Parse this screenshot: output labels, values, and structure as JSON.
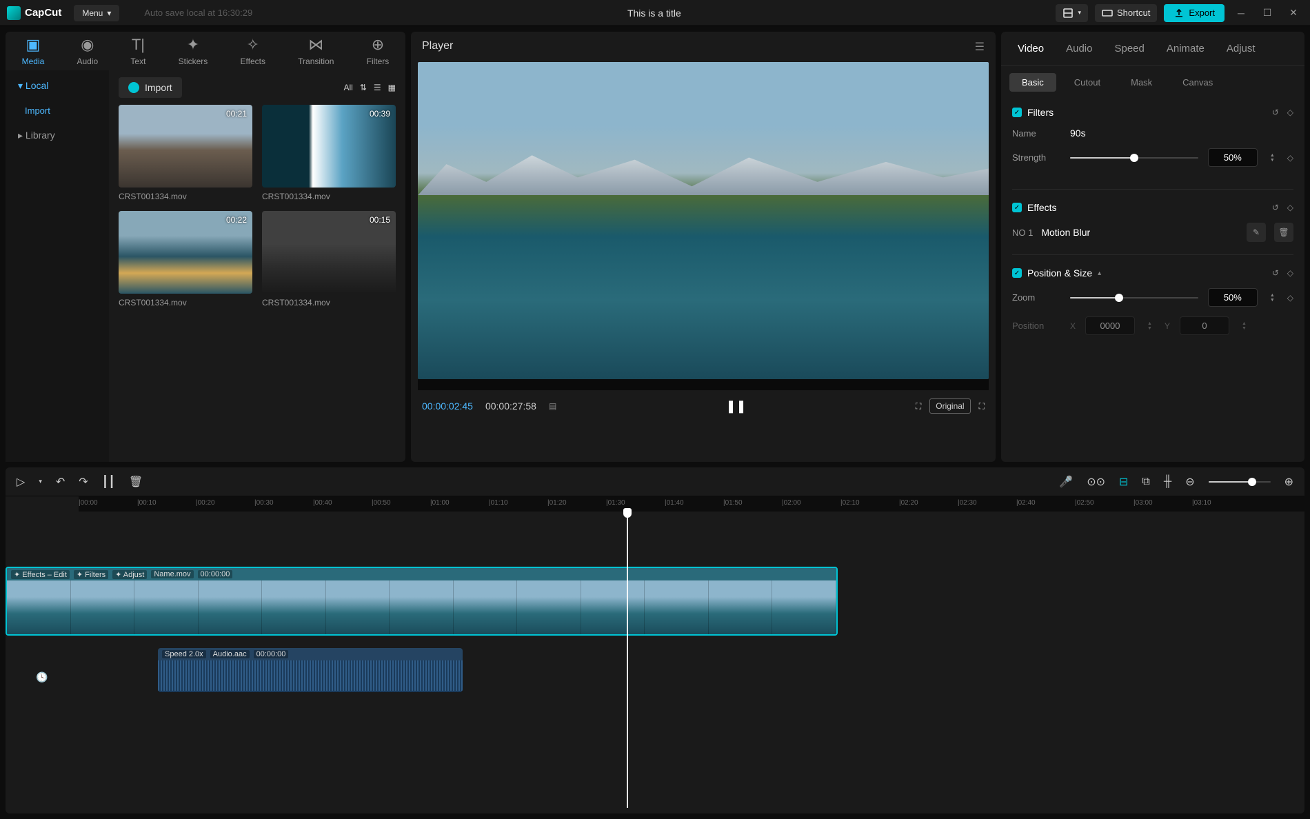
{
  "app": {
    "name": "CapCut",
    "menu_label": "Menu",
    "autosave": "Auto save local at 16:30:29",
    "title": "This is a title",
    "shortcut_label": "Shortcut",
    "export_label": "Export"
  },
  "tools": [
    {
      "label": "Media",
      "id": "media-tool",
      "active": true
    },
    {
      "label": "Audio",
      "id": "audio-tool",
      "active": false
    },
    {
      "label": "Text",
      "id": "text-tool",
      "active": false
    },
    {
      "label": "Stickers",
      "id": "stickers-tool",
      "active": false
    },
    {
      "label": "Effects",
      "id": "effects-tool",
      "active": false
    },
    {
      "label": "Transition",
      "id": "transition-tool",
      "active": false
    },
    {
      "label": "Filters",
      "id": "filters-tool",
      "active": false
    }
  ],
  "media": {
    "sidebar": [
      {
        "label": "Local",
        "id": "local",
        "active": true,
        "expanded": true,
        "sub": [
          {
            "label": "Import",
            "id": "local-import"
          }
        ]
      },
      {
        "label": "Library",
        "id": "library",
        "active": false,
        "expanded": false
      }
    ],
    "import_label": "Import",
    "filter_all": "All",
    "items": [
      {
        "name": "CRST001334.mov",
        "duration": "00:21",
        "thumb": "mountain-sky"
      },
      {
        "name": "CRST001334.mov",
        "duration": "00:39",
        "thumb": "wave-sky"
      },
      {
        "name": "CRST001334.mov",
        "duration": "00:22",
        "thumb": "lake-sky"
      },
      {
        "name": "CRST001334.mov",
        "duration": "00:15",
        "thumb": "mist-sky"
      }
    ]
  },
  "player": {
    "title": "Player",
    "current_time": "00:00:02:45",
    "total_time": "00:00:27:58",
    "original_label": "Original"
  },
  "inspector": {
    "tabs": [
      {
        "label": "Video",
        "active": true
      },
      {
        "label": "Audio",
        "active": false
      },
      {
        "label": "Speed",
        "active": false
      },
      {
        "label": "Animate",
        "active": false
      },
      {
        "label": "Adjust",
        "active": false
      }
    ],
    "subtabs": [
      {
        "label": "Basic",
        "active": true
      },
      {
        "label": "Cutout",
        "active": false
      },
      {
        "label": "Mask",
        "active": false
      },
      {
        "label": "Canvas",
        "active": false
      }
    ],
    "filters": {
      "title": "Filters",
      "name_label": "Name",
      "name_value": "90s",
      "strength_label": "Strength",
      "strength_pct": "50%"
    },
    "effects": {
      "title": "Effects",
      "no_label": "NO 1",
      "name": "Motion Blur"
    },
    "position": {
      "title": "Position & Size",
      "zoom_label": "Zoom",
      "zoom_pct": "50%",
      "position_label": "Position",
      "x_val": "0000",
      "y_label": "Y",
      "y_val": "0"
    }
  },
  "timeline": {
    "ruler": [
      "00:00",
      "00:10",
      "00:20",
      "00:30",
      "00:40",
      "00:50",
      "01:00",
      "01:10",
      "01:20",
      "01:30",
      "01:40",
      "01:50",
      "02:00",
      "02:10",
      "02:20",
      "02:30",
      "02:40",
      "02:50",
      "03:00",
      "03:10"
    ],
    "playhead_pct": 53,
    "video_clip": {
      "left_pct": 0,
      "width_pct": 71,
      "badges": [
        "Effects – Edit",
        "Filters",
        "Adjust"
      ],
      "file": "Name.mov",
      "time": "00:00:00"
    },
    "audio_clip": {
      "left_pct": 13,
      "width_pct": 26,
      "speed": "Speed 2.0x",
      "file": "Audio.aac",
      "time": "00:00:00"
    }
  }
}
